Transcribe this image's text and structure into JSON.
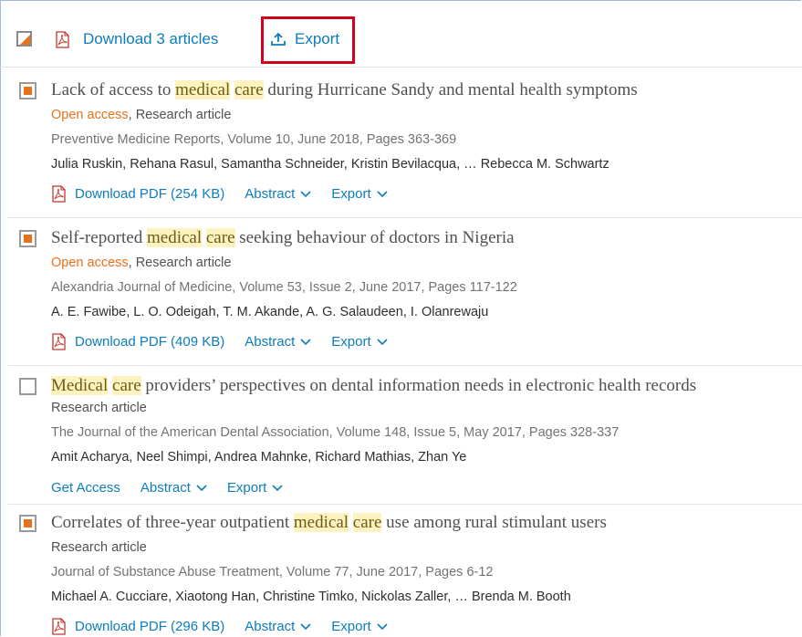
{
  "colors": {
    "accent": "#0c7dbb",
    "open_access": "#e9711c",
    "highlight_box": "#d0021b",
    "checkbox_fill": "#e9711c"
  },
  "toolbar": {
    "download_label": "Download 3 articles",
    "export_label": "Export"
  },
  "results": [
    {
      "title_parts": [
        "Lack of access to ",
        "medical",
        " ",
        "care",
        " during Hurricane Sandy and mental health symptoms"
      ],
      "open_access": "Open access",
      "type_sep": ", ",
      "article_type": "Research article",
      "source": "Preventive Medicine Reports, Volume 10, June 2018, Pages 363-369",
      "authors": "Julia Ruskin, Rehana Rasul, Samantha Schneider, Kristin Bevilacqua, … Rebecca M. Schwartz",
      "primary_action": "Download PDF (254 KB)",
      "abstract_label": "Abstract",
      "export_label": "Export",
      "checked": true
    },
    {
      "title_parts": [
        "Self-reported ",
        "medical",
        " ",
        "care",
        " seeking behaviour of doctors in Nigeria"
      ],
      "open_access": "Open access",
      "type_sep": ", ",
      "article_type": "Research article",
      "source": "Alexandria Journal of Medicine, Volume 53, Issue 2, June 2017, Pages 117-122",
      "authors": "A. E. Fawibe, L. O. Odeigah, T. M. Akande, A. G. Salaudeen, I. Olanrewaju",
      "primary_action": "Download PDF (409 KB)",
      "abstract_label": "Abstract",
      "export_label": "Export",
      "checked": true
    },
    {
      "title_parts": [
        "",
        "Medical",
        " ",
        "care",
        " providers’ perspectives on dental information needs in electronic health records"
      ],
      "article_type": "Research article",
      "source": "The Journal of the American Dental Association, Volume 148, Issue 5, May 2017, Pages 328-337",
      "authors": "Amit Acharya, Neel Shimpi, Andrea Mahnke, Richard Mathias, Zhan Ye",
      "primary_action": "Get Access",
      "abstract_label": "Abstract",
      "export_label": "Export",
      "checked": false
    },
    {
      "title_parts": [
        "Correlates of three-year outpatient ",
        "medical",
        " ",
        "care",
        " use among rural stimulant users"
      ],
      "article_type": "Research article",
      "source": "Journal of Substance Abuse Treatment, Volume 77, June 2017, Pages 6-12",
      "authors": "Michael A. Cucciare, Xiaotong Han, Christine Timko, Nickolas Zaller, … Brenda M. Booth",
      "primary_action": "Download PDF (296 KB)",
      "abstract_label": "Abstract",
      "export_label": "Export",
      "checked": true
    }
  ]
}
